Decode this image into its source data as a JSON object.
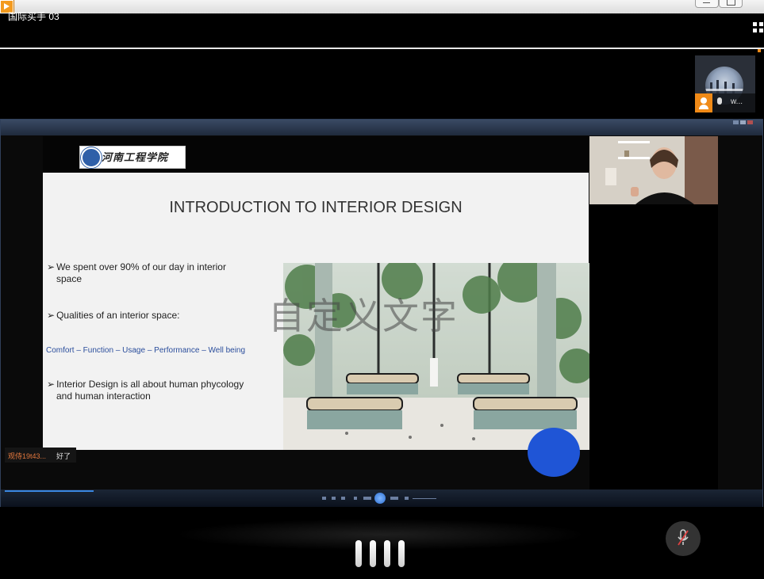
{
  "window": {
    "title": "国际买手 03"
  },
  "participant": {
    "name": "w..."
  },
  "slide": {
    "title": "INTRODUCTION TO INTERIOR DESIGN",
    "logo_text": "河南工程学院",
    "bullet_marker": "➢",
    "bullets": {
      "b1_line1": "We spent over 90% of our day in interior",
      "b1_line2": "space",
      "b2": "Qualities of an interior space:",
      "comfort": "Comfort – Function – Usage – Performance – Well being",
      "b3_line1": "Interior Design is all about human phycology",
      "b3_line2": "and human interaction"
    },
    "watermark": "自定义文字"
  },
  "chat": {
    "user": "观侍19t43...",
    "message": "好了"
  },
  "colors": {
    "accent_orange": "#f08a17",
    "blue_dot": "#1f55d6",
    "comfort_text": "#2b4e9c"
  }
}
